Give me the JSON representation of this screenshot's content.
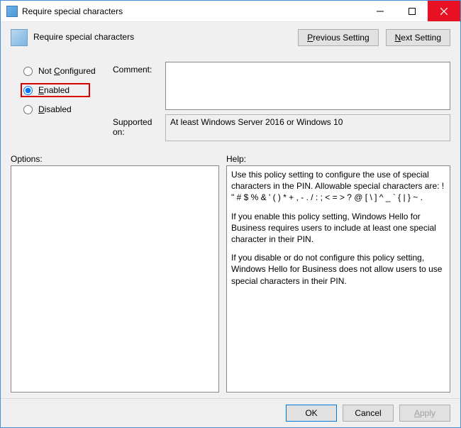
{
  "window": {
    "title": "Require special characters"
  },
  "policy": {
    "title": "Require special characters"
  },
  "nav": {
    "previous_label": "Previous Setting",
    "previous_u": "P",
    "next_label": "Next Setting",
    "next_u": "N"
  },
  "state": {
    "not_configured_label": "Not Configured",
    "not_configured_u": "C",
    "enabled_label": "Enabled",
    "enabled_u": "E",
    "disabled_label": "Disabled",
    "disabled_u": "D",
    "selected": "enabled"
  },
  "comment": {
    "label": "Comment:",
    "value": ""
  },
  "supported": {
    "label": "Supported on:",
    "value": "At least Windows Server 2016 or Windows 10"
  },
  "options": {
    "label": "Options:"
  },
  "help": {
    "label": "Help:",
    "p1": "Use this policy setting to configure the use of special characters in the PIN.  Allowable special characters are: ! \" # $ % & ' ( ) * + , - . / : ; < = > ? @ [ \\ ] ^ _ ` { | } ~ .",
    "p2": "If you enable this policy setting, Windows Hello for Business requires users to include at least one special character in their PIN.",
    "p3": "If you disable or do not configure this policy setting, Windows Hello for Business does not allow users to use special characters in their PIN."
  },
  "footer": {
    "ok": "OK",
    "cancel": "Cancel",
    "apply": "Apply",
    "apply_u": "A"
  }
}
